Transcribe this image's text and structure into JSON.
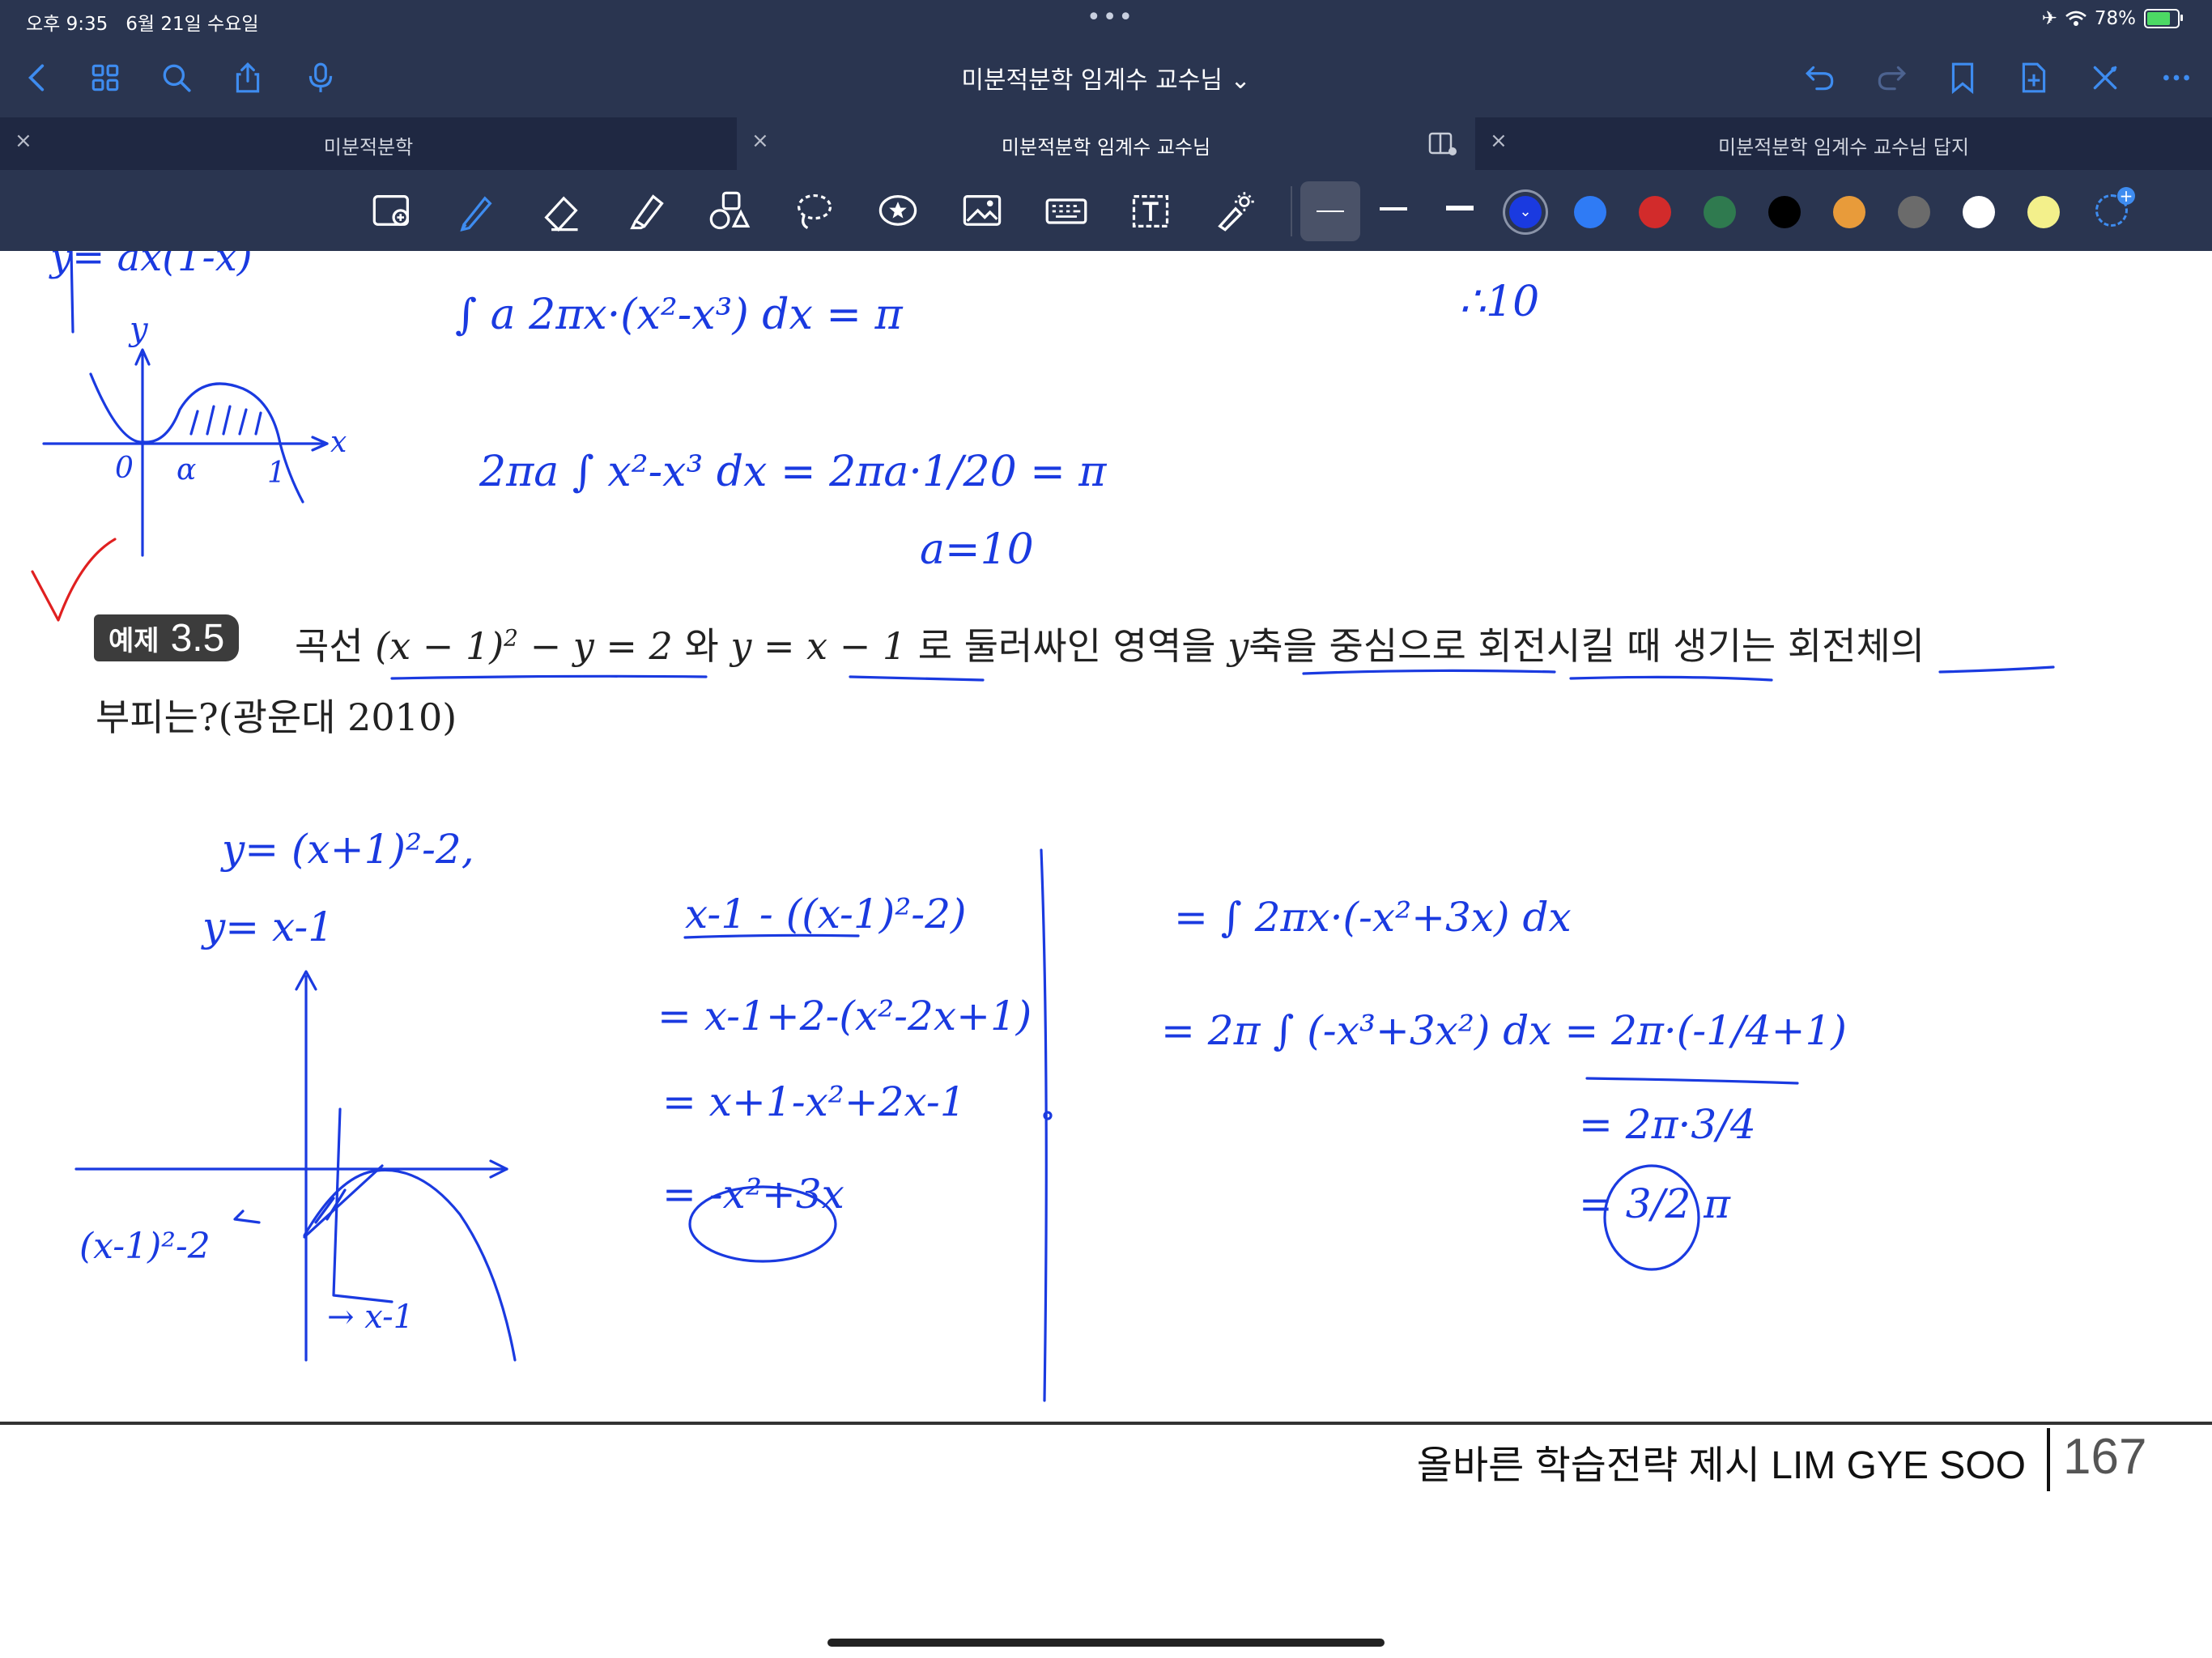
{
  "status_bar": {
    "time": "오후 9:35",
    "date": "6월 21일 수요일",
    "battery_percent": "78%",
    "battery_level": 0.78
  },
  "nav": {
    "title": "미분적분학 임계수 교수님",
    "title_chevron": "⌄"
  },
  "tabs": [
    {
      "label": "미분적분학",
      "close": "×",
      "active": false
    },
    {
      "label": "미분적분학 임계수 교수님",
      "close": "×",
      "active": true
    },
    {
      "label": "미분적분학 임계수 교수님 답지",
      "close": "×",
      "active": false
    }
  ],
  "toolbar": {
    "pen_color_selected": "#1a3ae0",
    "swatches": [
      "#1a3ae0",
      "#2f7bf5",
      "#d22b2b",
      "#2f7a4f",
      "#000000",
      "#e89b3a",
      "#6b6b6b",
      "#ffffff",
      "#f3f08b"
    ]
  },
  "problem": {
    "badge_label": "예제",
    "badge_number": "3.5",
    "line1_prefix": "곡선",
    "eq1_a": "(x − 1)",
    "eq1_exp": "2",
    "eq1_b": " − y = 2",
    "word_wa": "와",
    "eq2": "y = x − 1",
    "line1_mid": "로 둘러싸인 영역을",
    "var_y": "y",
    "line1_end": "축을 중심으로 회전시킬 때 생기는 회전체의",
    "line2": "부피는?(광운대 2010)"
  },
  "footer": {
    "text": "올바른 학습전략 제시 LIM GYE SOO",
    "page_number": "167"
  },
  "handwriting": {
    "top_left_eq": "y= ax(1-x)",
    "top_mid_1": "∫ a 2πx·(x²-x³) dx = π",
    "top_mid_2": "2πa ∫ x²-x³ dx = 2πa·1/20 = π",
    "top_mid_3": "a=10",
    "top_right": "∴10",
    "mid_left_1": "y= (x+1)²-2,",
    "mid_left_2": "y= x-1",
    "mid_mid_1": "x-1 - ((x-1)²-2)",
    "mid_mid_2": "= x-1+2-(x²-2x+1)",
    "mid_mid_3": "= x+1-x²+2x-1",
    "mid_mid_4": "= -x²+3x",
    "right_1": "= ∫ 2πx·(-x²+3x) dx",
    "right_2": "= 2π ∫ (-x³+3x²) dx = 2π·(-1/4+1)",
    "right_3": "= 2π·3/4",
    "right_4": "= 3/2 π",
    "graph_label_1": "(x-1)²-2",
    "graph_label_2": "→ x-1"
  }
}
